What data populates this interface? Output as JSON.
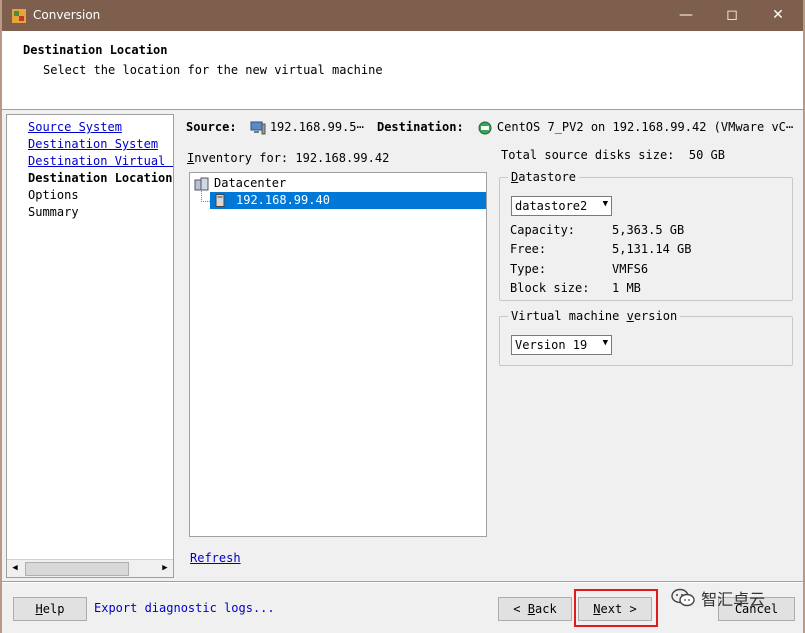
{
  "window": {
    "title": "Conversion"
  },
  "header": {
    "title": "Destination Location",
    "subtitle": "Select the location for the new virtual machine"
  },
  "nav": {
    "items": [
      {
        "label": "Source System",
        "state": "link"
      },
      {
        "label": "Destination System",
        "state": "link"
      },
      {
        "label": "Destination Virtual Machine",
        "state": "link"
      },
      {
        "label": "Destination Location",
        "state": "current"
      },
      {
        "label": "Options",
        "state": "plain"
      },
      {
        "label": "Summary",
        "state": "plain"
      }
    ]
  },
  "source_bar": {
    "source_label": "Source:",
    "source_value": "192.168.99.5⋯",
    "destination_label": "Destination:",
    "destination_value": "CentOS 7_PV2 on 192.168.99.42 (VMware vC⋯"
  },
  "inventory": {
    "label_prefix": "I",
    "label_rest": "nventory for: 192.168.99.42",
    "tree": {
      "datacenter": "Datacenter",
      "host": "192.168.99.40"
    },
    "refresh_label": "Refresh"
  },
  "disks": {
    "total_label": "Total source disks size:",
    "total_value": "50 GB"
  },
  "datastore": {
    "group_prefix": "D",
    "group_rest": "atastore",
    "selected": "datastore2",
    "capacity_label": "Capacity:",
    "capacity_value": "5,363.5 GB",
    "free_label": "Free:",
    "free_value": "5,131.14 GB",
    "type_label": "Type:",
    "type_value": "VMFS6",
    "block_label": "Block size:",
    "block_value": "1 MB"
  },
  "vm_version": {
    "group_pre": "Virtual machine ",
    "group_mn": "v",
    "group_post": "ersion",
    "selected": "Version 19"
  },
  "footer": {
    "help_mn": "H",
    "help_rest": "elp",
    "export_label": "Export diagnostic logs...",
    "back_arrow": "<",
    "back_mn": "B",
    "back_rest": "ack",
    "next_mn": "N",
    "next_rest": "ext",
    "next_arrow": ">",
    "cancel_label": "Cancel"
  },
  "watermark": {
    "text": "智汇卓云"
  },
  "colors": {
    "titlebar": "#7e5f4d",
    "selection": "#0078d7",
    "link": "#0000cc",
    "highlight": "#e11b1b"
  },
  "icons": [
    "app-icon",
    "minimize-icon",
    "maximize-icon",
    "close-icon",
    "computer-icon",
    "vcenter-icon",
    "datacenter-icon",
    "host-icon",
    "dropdown-arrow-icon",
    "wechat-icon"
  ]
}
